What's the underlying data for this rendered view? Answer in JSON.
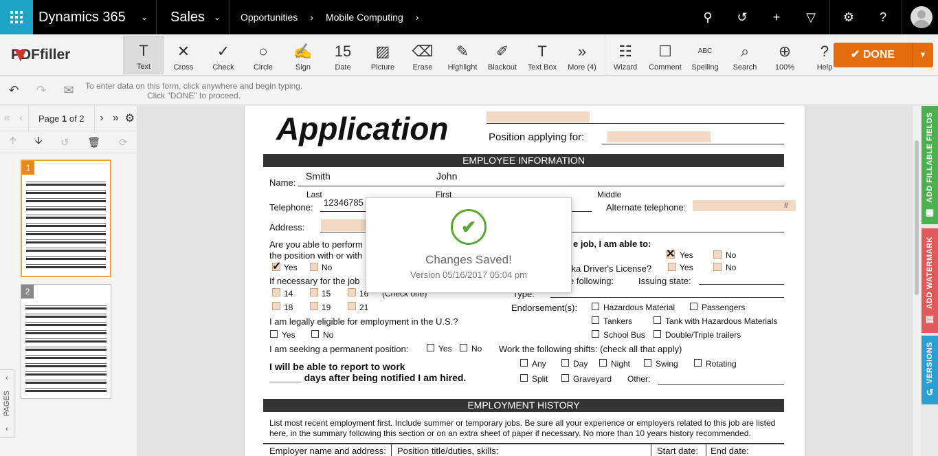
{
  "topnav": {
    "brand": "Dynamics 365",
    "app": "Sales",
    "crumbs": [
      "Opportunities",
      "Mobile Computing"
    ]
  },
  "toolbar": {
    "brand": "PDFfiller",
    "tools": [
      {
        "label": "Text",
        "icon": "T",
        "name": "text"
      },
      {
        "label": "Cross",
        "icon": "✕",
        "name": "cross"
      },
      {
        "label": "Check",
        "icon": "✓",
        "name": "check"
      },
      {
        "label": "Circle",
        "icon": "○",
        "name": "circle"
      },
      {
        "label": "Sign",
        "icon": "✍",
        "name": "sign"
      },
      {
        "label": "Date",
        "icon": "15",
        "name": "date"
      },
      {
        "label": "Picture",
        "icon": "▨",
        "name": "picture"
      },
      {
        "label": "Erase",
        "icon": "⌫",
        "name": "erase"
      },
      {
        "label": "Highlight",
        "icon": "✎",
        "name": "highlight"
      },
      {
        "label": "Blackout",
        "icon": "✐",
        "name": "blackout"
      },
      {
        "label": "Text Box",
        "icon": "T",
        "name": "text-box"
      },
      {
        "label": "More (4)",
        "icon": "»",
        "name": "more"
      }
    ],
    "tools2": [
      {
        "label": "Wizard",
        "icon": "☷",
        "name": "wizard"
      },
      {
        "label": "Comment",
        "icon": "☐",
        "name": "comment"
      },
      {
        "label": "Spelling",
        "icon": "ABC",
        "name": "spelling"
      },
      {
        "label": "Search",
        "icon": "⌕",
        "name": "search"
      },
      {
        "label": "100%",
        "icon": "⊕",
        "name": "zoom"
      },
      {
        "label": "Help",
        "icon": "?",
        "name": "help"
      }
    ],
    "done": "DONE"
  },
  "infobar": {
    "msg1": "To enter data on this form, click anywhere and begin typing.",
    "msg2": "Click \"DONE\" to proceed."
  },
  "pager": {
    "label": "Page",
    "current": "1",
    "of": "of 2"
  },
  "thumbs": [
    "1",
    "2"
  ],
  "pages_tab": "PAGES",
  "doc": {
    "title": "Application",
    "position_label": "Position applying for:",
    "section1": "EMPLOYEE INFORMATION",
    "name_label": "Name:",
    "last_val": "Smith",
    "first_val": "John",
    "last": "Last",
    "first": "First",
    "middle": "Middle",
    "tel_label": "Telephone:",
    "tel_val": "12346785",
    "alt_tel": "Alternate telephone:",
    "hash": "#",
    "address": "Address:",
    "perform_q1": "Are you able to perform",
    "perform_q2": "the position with or with",
    "job_q": "e job, I am able to:",
    "yes": "Yes",
    "no": "No",
    "license_q": "ska Driver's License?",
    "necessary": "If necessary for the job",
    "following": "e following:",
    "issuing": "Issuing state:",
    "ages": [
      "14",
      "15",
      "16",
      "18",
      "19",
      "21"
    ],
    "check_one": "(Check one)",
    "type": "Type:",
    "endorse": "Endorsement(s):",
    "endorsements": [
      "Hazardous Material",
      "Passengers",
      "Tankers",
      "Tank with Hazardous Materials",
      "School Bus",
      "Double/Triple trailers"
    ],
    "eligible": "I am legally eligible for employment in the U.S.?",
    "permanent": "I am seeking a permanent position:",
    "shifts_q": "Work the following shifts: (check all that apply)",
    "shifts": [
      "Any",
      "Day",
      "Night",
      "Swing",
      "Rotating",
      "Split",
      "Graveyard"
    ],
    "other": "Other:",
    "report1": "I will be able to report to work",
    "report2": "______ days after being notified I am hired.",
    "section2": "EMPLOYMENT HISTORY",
    "history1": "List most recent employment first. Include summer or temporary jobs. Be sure all your experience or employers related to this job are listed",
    "history2": "here, in the summary following this section or on an extra sheet of paper if necessary. No more than 10 years history recommended.",
    "col1": "Employer name and address:",
    "col2": "Position title/duties, skills:",
    "col3": "Start date:",
    "col4": "End date:"
  },
  "modal": {
    "title": "Changes Saved!",
    "version": "Version 05/16/2017 05:04 pm"
  },
  "rtabs": [
    {
      "label": "ADD FILLABLE FIELDS",
      "color": "#4caf50"
    },
    {
      "label": "ADD WATERMARK",
      "color": "#e05a5a"
    },
    {
      "label": "VERSIONS",
      "color": "#2a9fd6"
    }
  ]
}
